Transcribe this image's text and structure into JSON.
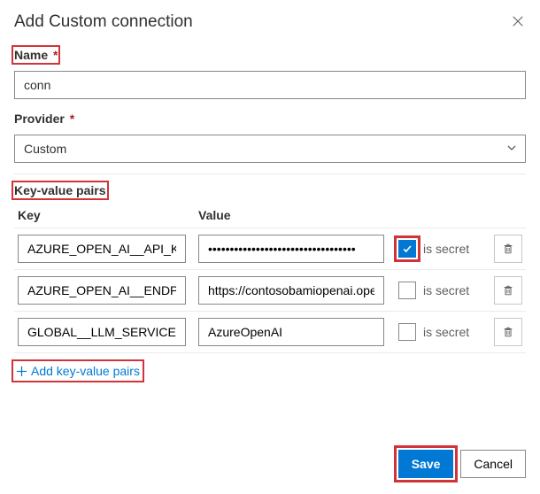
{
  "dialog": {
    "title": "Add Custom connection"
  },
  "name": {
    "label": "Name",
    "required": "*",
    "value": "conn"
  },
  "provider": {
    "label": "Provider",
    "required": "*",
    "value": "Custom"
  },
  "kv": {
    "section_label": "Key-value pairs",
    "key_header": "Key",
    "value_header": "Value",
    "secret_label": "is secret",
    "add_label": "Add key-value pairs",
    "rows": [
      {
        "key": "AZURE_OPEN_AI__API_KEY",
        "value": "••••••••••••••••••••••••••••••••••",
        "is_secret": true
      },
      {
        "key": "AZURE_OPEN_AI__ENDPOINT",
        "value": "https://contosobamiopenai.ope",
        "is_secret": false
      },
      {
        "key": "GLOBAL__LLM_SERVICE",
        "value": "AzureOpenAI",
        "is_secret": false
      }
    ]
  },
  "footer": {
    "save": "Save",
    "cancel": "Cancel"
  }
}
